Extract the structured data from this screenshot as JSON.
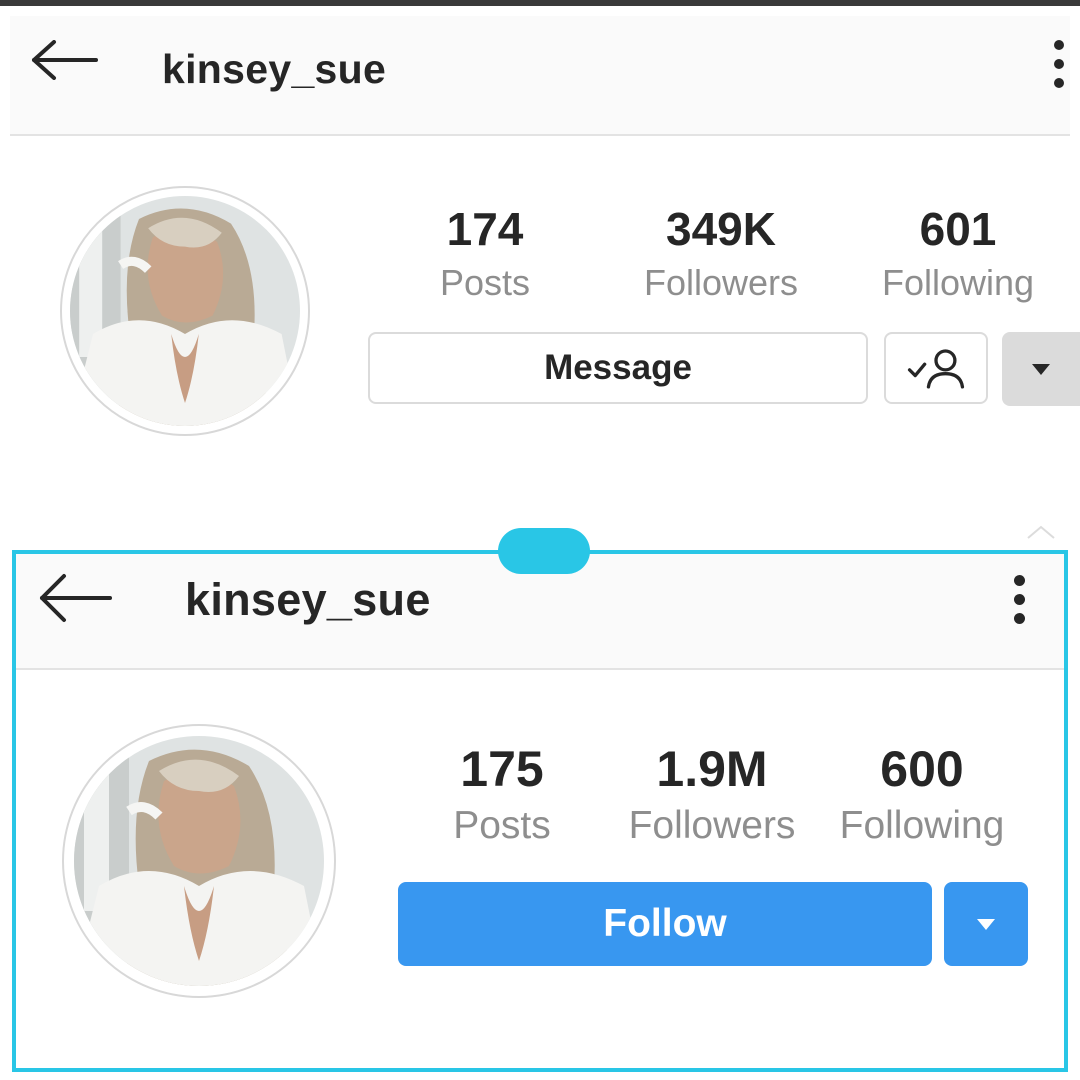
{
  "panel_top": {
    "header": {
      "username": "kinsey_sue"
    },
    "stats": [
      {
        "value": "174",
        "label": "Posts"
      },
      {
        "value": "349K",
        "label": "Followers"
      },
      {
        "value": "601",
        "label": "Following"
      }
    ],
    "message_button": "Message"
  },
  "panel_bottom": {
    "header": {
      "username": "kinsey_sue"
    },
    "stats": [
      {
        "value": "175",
        "label": "Posts"
      },
      {
        "value": "1.9M",
        "label": "Followers"
      },
      {
        "value": "600",
        "label": "Following"
      }
    ],
    "follow_button": "Follow"
  },
  "colors": {
    "highlight_frame": "#29c6e6",
    "follow_blue": "#3897f0",
    "text_primary": "#262626",
    "text_secondary": "#8e8e8e"
  },
  "icons": [
    "back-arrow-icon",
    "more-options-icon",
    "following-check-person-icon",
    "caret-down-icon"
  ]
}
